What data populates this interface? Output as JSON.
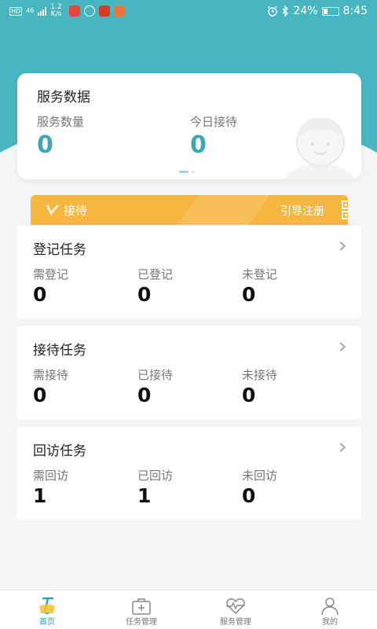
{
  "status_bar": {
    "network": "46",
    "speed_value": "1.2",
    "speed_unit": "K/s",
    "battery": "24%",
    "time": "8:45"
  },
  "service_data": {
    "title": "服务数据",
    "stats": [
      {
        "label": "服务数量",
        "value": "0"
      },
      {
        "label": "今日接待",
        "value": "0"
      }
    ]
  },
  "banner": {
    "left_label": "接待",
    "right_label": "引导注册"
  },
  "tasks": [
    {
      "title": "登记任务",
      "items": [
        {
          "label": "需登记",
          "value": "0"
        },
        {
          "label": "已登记",
          "value": "0"
        },
        {
          "label": "未登记",
          "value": "0"
        }
      ]
    },
    {
      "title": "接待任务",
      "items": [
        {
          "label": "需接待",
          "value": "0"
        },
        {
          "label": "已接待",
          "value": "0"
        },
        {
          "label": "未接待",
          "value": "0"
        }
      ]
    },
    {
      "title": "回访任务",
      "items": [
        {
          "label": "需回访",
          "value": "1"
        },
        {
          "label": "已回访",
          "value": "1"
        },
        {
          "label": "未回访",
          "value": "0"
        }
      ]
    }
  ],
  "tab_bar": [
    {
      "label": "首页",
      "icon": "home-icon",
      "active": true
    },
    {
      "label": "任务管理",
      "icon": "medical-box-icon",
      "active": false
    },
    {
      "label": "服务管理",
      "icon": "heartbeat-icon",
      "active": false
    },
    {
      "label": "我的",
      "icon": "person-icon",
      "active": false
    }
  ],
  "colors": {
    "header_teal": "#47b6c1",
    "accent_teal": "#3aa9b4",
    "banner_orange": "#f6b740",
    "background": "#f4f5f6"
  }
}
